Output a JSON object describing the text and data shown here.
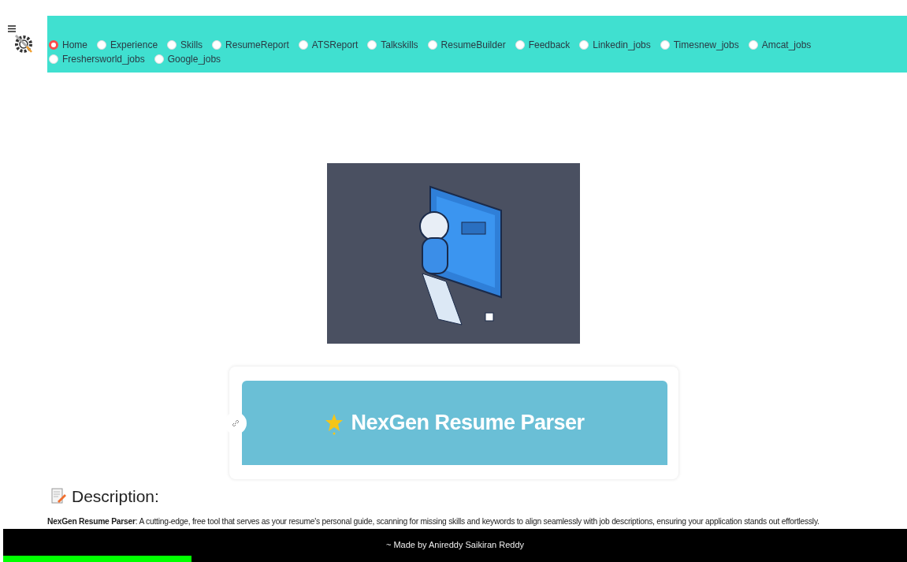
{
  "nav": {
    "items": [
      {
        "label": "Home",
        "selected": true
      },
      {
        "label": "Experience",
        "selected": false
      },
      {
        "label": "Skills",
        "selected": false
      },
      {
        "label": "ResumeReport",
        "selected": false
      },
      {
        "label": "ATSReport",
        "selected": false
      },
      {
        "label": "Talkskills",
        "selected": false
      },
      {
        "label": "ResumeBuilder",
        "selected": false
      },
      {
        "label": "Feedback",
        "selected": false
      },
      {
        "label": "Linkedin_jobs",
        "selected": false
      },
      {
        "label": "Timesnew_jobs",
        "selected": false
      },
      {
        "label": "Amcat_jobs",
        "selected": false
      },
      {
        "label": "Freshersworld_jobs",
        "selected": false
      },
      {
        "label": "Google_jobs",
        "selected": false
      }
    ]
  },
  "hero": {
    "title": "NexGen Resume Parser"
  },
  "description": {
    "heading": "Description:",
    "text": "**NexGen Resume Parser**: A cutting-edge, free tool that serves as your resume's personal guide, scanning for missing skills and keywords to align seamlessly with job descriptions, ensuring your application stands out effortlessly."
  },
  "footer": {
    "text": "~ Made by Anireddy Saikiran Reddy"
  }
}
